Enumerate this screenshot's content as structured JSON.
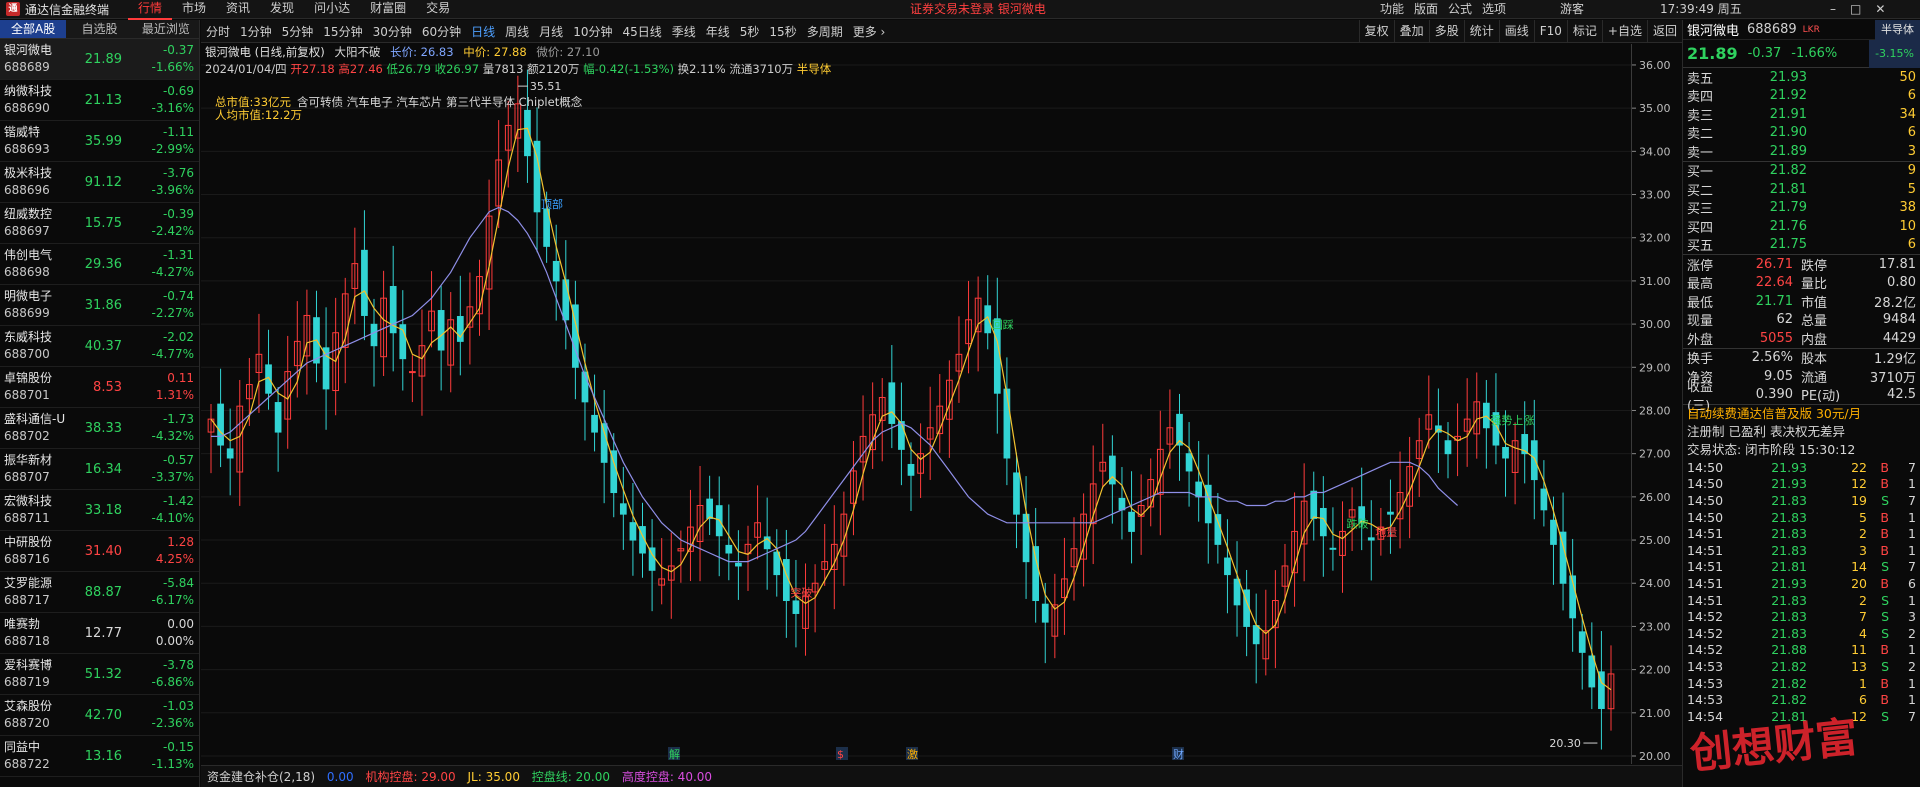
{
  "titlebar": {
    "app_name": "通达信金融终端",
    "menus": [
      "行情",
      "市场",
      "资讯",
      "发现",
      "问小达",
      "财富圈",
      "交易"
    ],
    "active_menu": "行情",
    "notice": "证券交易未登录  银河微电",
    "right_menus": [
      "功能",
      "版面",
      "公式",
      "选项"
    ],
    "user": "游客",
    "clock": "17:39:49 周五"
  },
  "watchlist": {
    "tabs": [
      "全部A股",
      "自选股",
      "最近浏览"
    ],
    "items": [
      {
        "name": "银河微电",
        "code": "688689",
        "price": "21.89",
        "change": "-0.37",
        "pct": "-1.66%",
        "dir": "dn"
      },
      {
        "name": "纳微科技",
        "code": "688690",
        "price": "21.13",
        "change": "-0.69",
        "pct": "-3.16%",
        "dir": "dn"
      },
      {
        "name": "锴威特",
        "code": "688693",
        "price": "35.99",
        "change": "-1.11",
        "pct": "-2.99%",
        "dir": "dn"
      },
      {
        "name": "极米科技",
        "code": "688696",
        "price": "91.12",
        "change": "-3.76",
        "pct": "-3.96%",
        "dir": "dn"
      },
      {
        "name": "纽威数控",
        "code": "688697",
        "price": "15.75",
        "change": "-0.39",
        "pct": "-2.42%",
        "dir": "dn"
      },
      {
        "name": "伟创电气",
        "code": "688698",
        "price": "29.36",
        "change": "-1.31",
        "pct": "-4.27%",
        "dir": "dn"
      },
      {
        "name": "明微电子",
        "code": "688699",
        "price": "31.86",
        "change": "-0.74",
        "pct": "-2.27%",
        "dir": "dn"
      },
      {
        "name": "东威科技",
        "code": "688700",
        "price": "40.37",
        "change": "-2.02",
        "pct": "-4.77%",
        "dir": "dn"
      },
      {
        "name": "卓锦股份",
        "code": "688701",
        "price": "8.53",
        "change": "0.11",
        "pct": "1.31%",
        "dir": "up"
      },
      {
        "name": "盛科通信-U",
        "code": "688702",
        "price": "38.33",
        "change": "-1.73",
        "pct": "-4.32%",
        "dir": "dn"
      },
      {
        "name": "振华新材",
        "code": "688707",
        "price": "16.34",
        "change": "-0.57",
        "pct": "-3.37%",
        "dir": "dn"
      },
      {
        "name": "宏微科技",
        "code": "688711",
        "price": "33.18",
        "change": "-1.42",
        "pct": "-4.10%",
        "dir": "dn"
      },
      {
        "name": "中研股份",
        "code": "688716",
        "price": "31.40",
        "change": "1.28",
        "pct": "4.25%",
        "dir": "up"
      },
      {
        "name": "艾罗能源",
        "code": "688717",
        "price": "88.87",
        "change": "-5.84",
        "pct": "-6.17%",
        "dir": "dn"
      },
      {
        "name": "唯赛勃",
        "code": "688718",
        "price": "12.77",
        "change": "0.00",
        "pct": "0.00%",
        "dir": "eq"
      },
      {
        "name": "爱科赛博",
        "code": "688719",
        "price": "51.32",
        "change": "-3.78",
        "pct": "-6.86%",
        "dir": "dn"
      },
      {
        "name": "艾森股份",
        "code": "688720",
        "price": "42.70",
        "change": "-1.03",
        "pct": "-2.36%",
        "dir": "dn"
      },
      {
        "name": "同益中",
        "code": "688722",
        "price": "13.16",
        "change": "-0.15",
        "pct": "-1.13%",
        "dir": "dn"
      }
    ]
  },
  "toolbar": {
    "periods": [
      "分时",
      "1分钟",
      "5分钟",
      "15分钟",
      "30分钟",
      "60分钟",
      "日线",
      "周线",
      "月线",
      "10分钟",
      "45日线",
      "季线",
      "年线",
      "5秒",
      "15秒",
      "多周期",
      "更多 ›"
    ],
    "active_period": "日线",
    "tools": [
      "复权",
      "叠加",
      "多股",
      "统计",
      "画线",
      "F10",
      "标记",
      "+自选",
      "返回"
    ]
  },
  "chart_header": {
    "title": "银河微电 (日线,前复权)",
    "pattern": "大阳不破",
    "long_price": "长价: 26.83",
    "mid_price": "中价: 27.88",
    "short_price": "微价: 27.10",
    "date": "2024/01/04/四",
    "open": "开27.18",
    "high": "高27.46",
    "low": "低26.79",
    "close": "收26.97",
    "volume": "量7813",
    "amount": "额2120万",
    "amplitude": "幅-0.42(-1.53%)",
    "turnover": "换2.11%",
    "float": "流通3710万",
    "sector": "半导体"
  },
  "chart_annotations": {
    "market_cap": "总市值:33亿元",
    "per_capita": "人均市值:12.2万",
    "concepts": "含可转债 汽车电子 汽车芯片 第三代半导体 Chiplet概念",
    "max_label": "35.51",
    "min_label": "20.30",
    "signals": [
      "顶部",
      "突破",
      "回踩",
      "地量",
      "跌破",
      "强势上涨"
    ],
    "event_marks": [
      "解",
      "$",
      "激",
      "财"
    ]
  },
  "chart_data": {
    "type": "line",
    "title": "银河微电 (日线,前复权)",
    "y_ticks": [
      36.0,
      35.0,
      34.0,
      33.0,
      32.0,
      31.0,
      30.0,
      29.0,
      28.0,
      27.0,
      26.0,
      25.0,
      24.0,
      23.0,
      22.0,
      21.0,
      20.0
    ],
    "ylim": [
      20.0,
      36.3
    ],
    "series": [
      {
        "name": "close",
        "values": [
          27.8,
          27.2,
          26.9,
          28.1,
          28.6,
          29.3,
          28.4,
          27.5,
          28.9,
          29.6,
          30.2,
          29.1,
          28.5,
          29.8,
          30.7,
          31.4,
          30.2,
          29.5,
          30.6,
          29.8,
          29.2,
          28.9,
          29.5,
          30.3,
          29.4,
          30.1,
          29.6,
          30.4,
          31.1,
          32.5,
          33.8,
          34.6,
          35.1,
          33.9,
          32.6,
          31.8,
          31.0,
          30.1,
          29.0,
          28.2,
          27.5,
          26.8,
          26.1,
          25.6,
          25.0,
          24.7,
          24.3,
          24.1,
          24.4,
          24.8,
          25.3,
          25.8,
          25.5,
          25.1,
          24.7,
          24.4,
          24.9,
          25.4,
          24.8,
          24.2,
          23.6,
          23.3,
          23.7,
          24.0,
          24.5,
          24.9,
          25.6,
          26.6,
          27.4,
          27.9,
          28.3,
          27.7,
          27.1,
          26.5,
          27.0,
          27.6,
          28.1,
          28.7,
          29.3,
          30.1,
          30.6,
          29.8,
          28.4,
          26.9,
          25.6,
          24.5,
          23.6,
          23.1,
          23.5,
          24.1,
          24.8,
          25.6,
          26.3,
          26.8,
          26.3,
          25.7,
          25.2,
          25.8,
          26.4,
          27.1,
          27.6,
          27.2,
          26.6,
          26.0,
          25.4,
          24.9,
          24.2,
          23.5,
          23.0,
          22.6,
          22.9,
          23.6,
          24.4,
          25.2,
          25.9,
          25.5,
          25.1,
          24.8,
          25.2,
          25.7,
          25.4,
          25.0,
          25.3,
          25.6,
          26.1,
          26.7,
          27.3,
          27.9,
          27.5,
          27.0,
          27.4,
          27.8,
          28.2,
          27.6,
          27.2,
          26.9,
          27.3,
          27.0,
          26.4,
          25.7,
          24.9,
          24.0,
          23.2,
          22.4,
          21.6,
          21.1,
          21.9
        ]
      },
      {
        "name": "MA",
        "values": [
          27.4,
          27.4,
          27.5,
          27.7,
          27.9,
          28.1,
          28.3,
          28.5,
          28.7,
          28.9,
          29.1,
          29.2,
          29.3,
          29.4,
          29.5,
          29.6,
          29.7,
          29.8,
          29.9,
          30.0,
          30.1,
          30.2,
          30.4,
          30.6,
          30.9,
          31.2,
          31.6,
          32.0,
          32.3,
          32.6,
          32.7,
          32.6,
          32.4,
          32.1,
          31.7,
          31.2,
          30.6,
          30.0,
          29.4,
          28.8,
          28.3,
          27.8,
          27.3,
          26.8,
          26.4,
          26.0,
          25.7,
          25.4,
          25.2,
          25.0,
          24.9,
          24.8,
          24.7,
          24.6,
          24.5,
          24.5,
          24.5,
          24.6,
          24.7,
          24.8,
          24.9,
          25.0,
          25.2,
          25.5,
          25.8,
          26.1,
          26.4,
          26.7,
          27.0,
          27.3,
          27.5,
          27.6,
          27.7,
          27.6,
          27.4,
          27.2,
          26.9,
          26.6,
          26.3,
          26.0,
          25.8,
          25.6,
          25.5,
          25.4,
          25.4,
          25.4,
          25.4,
          25.4,
          25.4,
          25.4,
          25.4,
          25.4,
          25.4,
          25.5,
          25.6,
          25.7,
          25.8,
          25.9,
          26.0,
          26.1,
          26.1,
          26.1,
          26.1,
          26.0,
          26.0,
          26.0,
          25.9,
          25.9,
          25.8,
          25.8,
          25.8,
          25.9,
          25.9,
          26.0,
          26.0,
          26.1,
          26.1,
          26.2,
          26.3,
          26.4,
          26.5,
          26.6,
          26.7,
          26.8,
          26.8,
          26.8,
          26.7,
          26.5,
          26.2,
          26.0,
          25.8
        ]
      }
    ],
    "xlabel": "",
    "ylabel": ""
  },
  "bottom_indicator": {
    "name": "资金建仓补仓(2,18)",
    "v1": "0.00",
    "v2": "机构控盘: 29.00",
    "v3": "JL: 35.00",
    "v4": "控盘线: 20.00",
    "v5": "高度控盘: 40.00"
  },
  "quote_panel": {
    "name": "银河微电",
    "code": "688689",
    "tags": "LKR",
    "sector": "半导体",
    "sector_pct": "-3.15%",
    "price": "21.89",
    "change": "-0.37",
    "pct": "-1.66%",
    "asks": [
      {
        "label": "卖五",
        "price": "21.93",
        "vol": "50"
      },
      {
        "label": "卖四",
        "price": "21.92",
        "vol": "6"
      },
      {
        "label": "卖三",
        "price": "21.91",
        "vol": "34"
      },
      {
        "label": "卖二",
        "price": "21.90",
        "vol": "6"
      },
      {
        "label": "卖一",
        "price": "21.89",
        "vol": "3"
      }
    ],
    "bids": [
      {
        "label": "买一",
        "price": "21.82",
        "vol": "9"
      },
      {
        "label": "买二",
        "price": "21.81",
        "vol": "5"
      },
      {
        "label": "买三",
        "price": "21.79",
        "vol": "38"
      },
      {
        "label": "买四",
        "price": "21.76",
        "vol": "10"
      },
      {
        "label": "买五",
        "price": "21.75",
        "vol": "6"
      }
    ],
    "stats": [
      {
        "k": "涨停",
        "v": "26.71",
        "vc": "up",
        "k2": "跌停",
        "v2": "17.81",
        "v2c": "dn"
      },
      {
        "k": "最高",
        "v": "22.64",
        "vc": "up",
        "k2": "量比",
        "v2": "0.80",
        "v2c": "dn"
      },
      {
        "k": "最低",
        "v": "21.71",
        "vc": "dn",
        "k2": "市值",
        "v2": "28.2亿",
        "v2c": "eq"
      },
      {
        "k": "现量",
        "v": "62",
        "vc": "eq",
        "k2": "总量",
        "v2": "9484",
        "v2c": "eq"
      },
      {
        "k": "外盘",
        "v": "5055",
        "vc": "up",
        "k2": "内盘",
        "v2": "4429",
        "v2c": "dn"
      }
    ],
    "stats2": [
      {
        "k": "换手",
        "v": "2.56%",
        "k2": "股本",
        "v2": "1.29亿"
      },
      {
        "k": "净资",
        "v": "9.05",
        "k2": "流通",
        "v2": "3710万"
      },
      {
        "k": "收益(三)",
        "v": "0.390",
        "k2": "PE(动)",
        "v2": "42.5"
      }
    ],
    "ad_line": "自动续费通达信普及版 30元/月",
    "reg_line": "注册制 已盈利 表决权无差异",
    "trade_status": "交易状态: 闭市阶段 15:30:12",
    "ticks": [
      {
        "t": "14:50",
        "p": "21.93",
        "v": "22",
        "f": "B",
        "n": "7",
        "dir": "dn"
      },
      {
        "t": "14:50",
        "p": "21.93",
        "v": "12",
        "f": "B",
        "n": "1",
        "dir": "dn"
      },
      {
        "t": "14:50",
        "p": "21.83",
        "v": "19",
        "f": "S",
        "n": "7",
        "dir": "dn"
      },
      {
        "t": "14:50",
        "p": "21.83",
        "v": "5",
        "f": "B",
        "n": "1",
        "dir": "dn"
      },
      {
        "t": "14:51",
        "p": "21.83",
        "v": "2",
        "f": "B",
        "n": "1",
        "dir": "dn"
      },
      {
        "t": "14:51",
        "p": "21.83",
        "v": "3",
        "f": "B",
        "n": "1",
        "dir": "dn"
      },
      {
        "t": "14:51",
        "p": "21.81",
        "v": "14",
        "f": "S",
        "n": "7",
        "dir": "dn"
      },
      {
        "t": "14:51",
        "p": "21.93",
        "v": "20",
        "f": "B",
        "n": "6",
        "dir": "dn"
      },
      {
        "t": "14:51",
        "p": "21.83",
        "v": "2",
        "f": "S",
        "n": "1",
        "dir": "dn"
      },
      {
        "t": "14:52",
        "p": "21.83",
        "v": "7",
        "f": "S",
        "n": "3",
        "dir": "dn"
      },
      {
        "t": "14:52",
        "p": "21.83",
        "v": "4",
        "f": "S",
        "n": "2",
        "dir": "dn"
      },
      {
        "t": "14:52",
        "p": "21.88",
        "v": "11",
        "f": "B",
        "n": "1",
        "dir": "dn"
      },
      {
        "t": "14:53",
        "p": "21.82",
        "v": "13",
        "f": "S",
        "n": "2",
        "dir": "dn"
      },
      {
        "t": "14:53",
        "p": "21.82",
        "v": "1",
        "f": "B",
        "n": "1",
        "dir": "dn"
      },
      {
        "t": "14:53",
        "p": "21.82",
        "v": "6",
        "f": "B",
        "n": "1",
        "dir": "dn"
      },
      {
        "t": "14:54",
        "p": "21.81",
        "v": "12",
        "f": "S",
        "n": "7",
        "dir": "dn"
      }
    ]
  },
  "watermark": "创想财富"
}
